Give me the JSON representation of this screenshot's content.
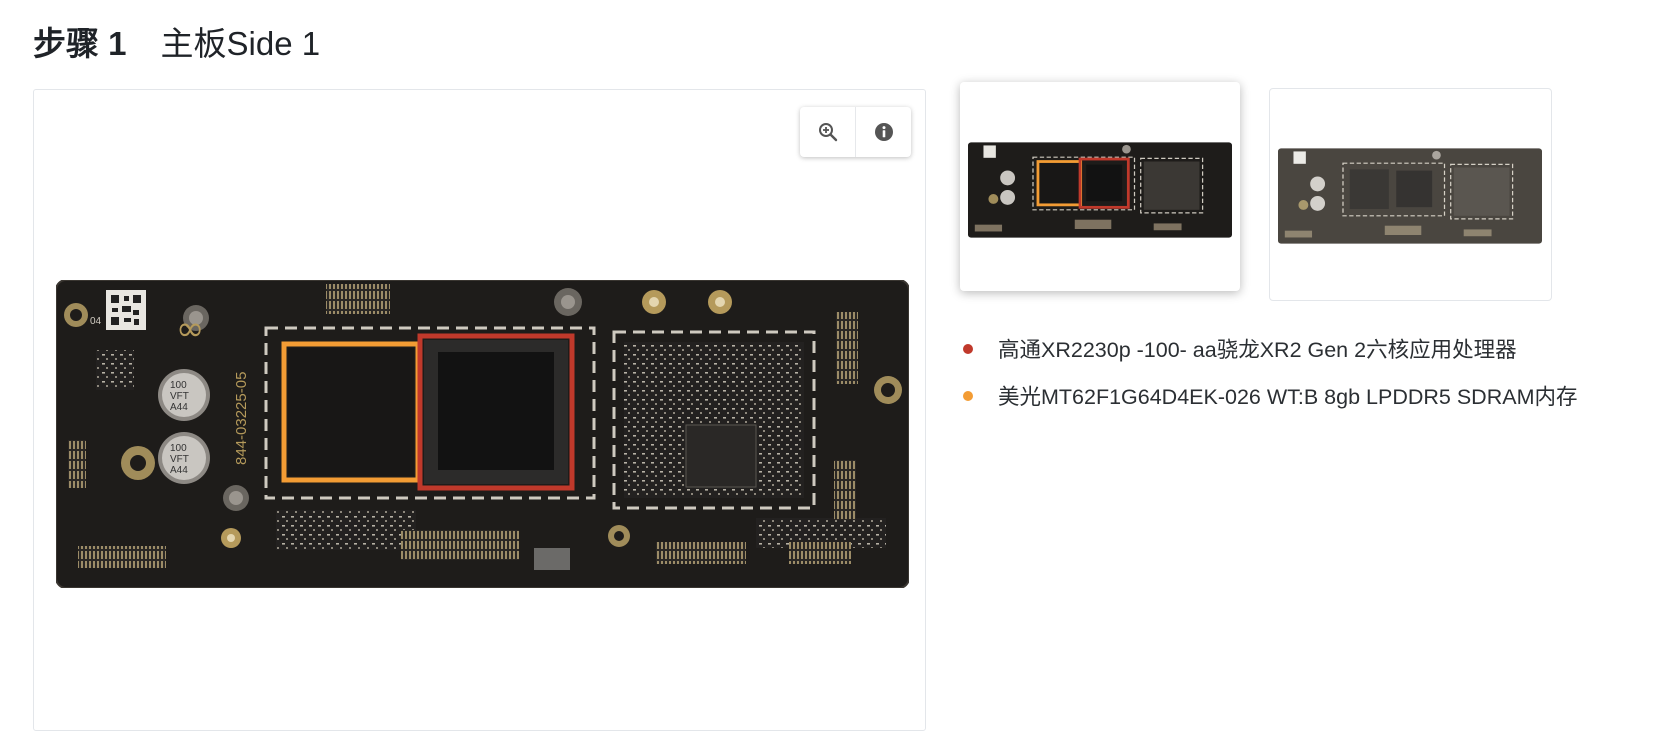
{
  "step": {
    "label": "步骤 1",
    "title": "主板Side 1"
  },
  "toolbar": {
    "zoom_icon": "zoom-in-icon",
    "info_icon": "info-icon"
  },
  "board_markings": {
    "part_number": "844-03225-05",
    "cap_1": [
      "100",
      "VFT",
      "A44"
    ],
    "cap_2": [
      "100",
      "VFT",
      "A44"
    ],
    "corner_mark": "04"
  },
  "thumbnails": [
    {
      "label": "annotated",
      "selected": true
    },
    {
      "label": "plain",
      "selected": false
    }
  ],
  "bullets": [
    {
      "color": "#c0392b",
      "text": "高通XR2230p -100- aa骁龙XR2 Gen 2六核应用处理器"
    },
    {
      "color": "#f39c34",
      "text": "美光MT62F1G64D4EK-026 WT:B 8gb LPDDR5 SDRAM内存"
    }
  ],
  "colors": {
    "highlight_red": "#c0392b",
    "highlight_orange": "#f39c34",
    "board": "#1e1c1a",
    "silk": "#cfcac0",
    "gold": "#b59a5b"
  }
}
